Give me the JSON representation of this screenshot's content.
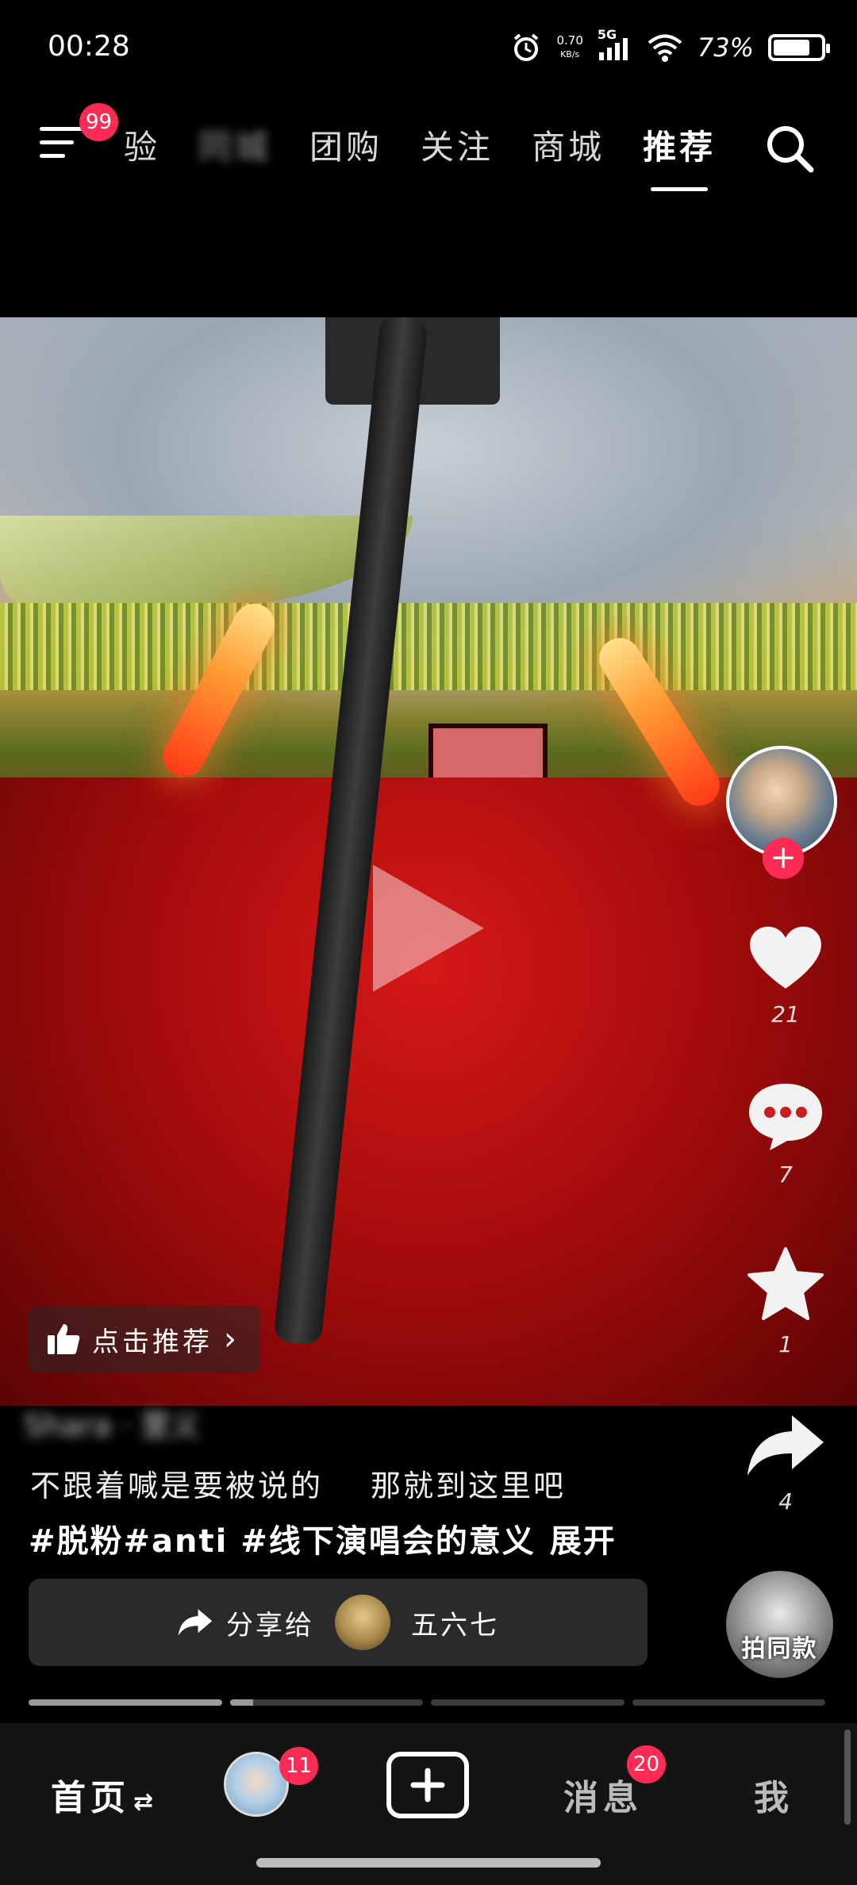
{
  "status_bar": {
    "time": "00:28",
    "net_speed_value": "0.70",
    "net_speed_unit": "KB/s",
    "network": "5G",
    "battery_percent": "73%"
  },
  "top_nav": {
    "menu_badge": "99",
    "tabs": [
      {
        "label": "体验",
        "state": "partially-hidden"
      },
      {
        "label": "同城",
        "state": "blurred"
      },
      {
        "label": "团购",
        "state": "normal"
      },
      {
        "label": "关注",
        "state": "normal"
      },
      {
        "label": "商城",
        "state": "normal"
      },
      {
        "label": "推荐",
        "state": "active"
      }
    ]
  },
  "video": {
    "recommend_chip_label": "点击推荐"
  },
  "actions": {
    "like_count": "21",
    "comment_count": "7",
    "favorite_count": "1",
    "share_count": "4",
    "same_style_label": "拍同款"
  },
  "caption": {
    "author_name": "Shara · 里义",
    "text_part1": "不跟着喊是要被说的",
    "text_part2": "那就到这里吧",
    "tags": "#脱粉#anti #线下演唱会的意义",
    "expand_label": "展开"
  },
  "share_bar": {
    "label": "分享给",
    "friend_name": "五六七"
  },
  "progress": {
    "segments": [
      1.0,
      0.12,
      0.0,
      0.0
    ]
  },
  "bottom_nav": {
    "home_label": "首页",
    "home_swap_icon": "⇄",
    "friend_badge": "11",
    "messages_label": "消息",
    "messages_badge": "20",
    "me_label": "我"
  },
  "colors": {
    "accent_badge": "#fe2c55",
    "background": "#000000",
    "bottom_nav_bg": "#141414"
  }
}
